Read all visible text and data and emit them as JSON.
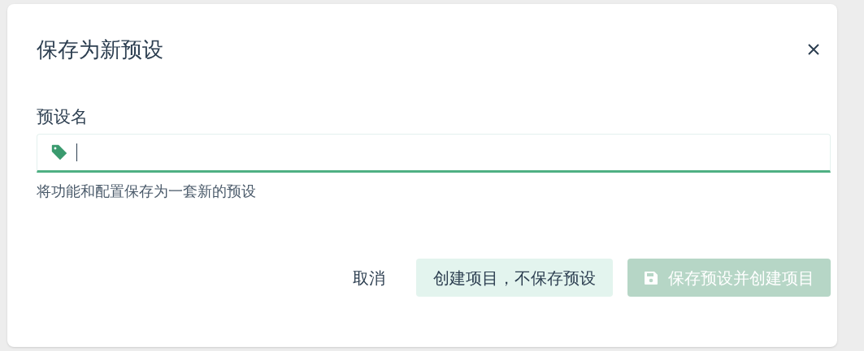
{
  "dialog": {
    "title": "保存为新预设"
  },
  "field": {
    "label": "预设名",
    "focused": true,
    "helper": "将功能和配置保存为一套新的预设"
  },
  "buttons": [
    {
      "label": "取消",
      "kind": "text",
      "disabled": false
    },
    {
      "label": "创建项目，不保存预设",
      "kind": "secondary",
      "disabled": false
    },
    {
      "label": "保存预设并创建项目",
      "kind": "primary",
      "disabled": true
    }
  ]
}
